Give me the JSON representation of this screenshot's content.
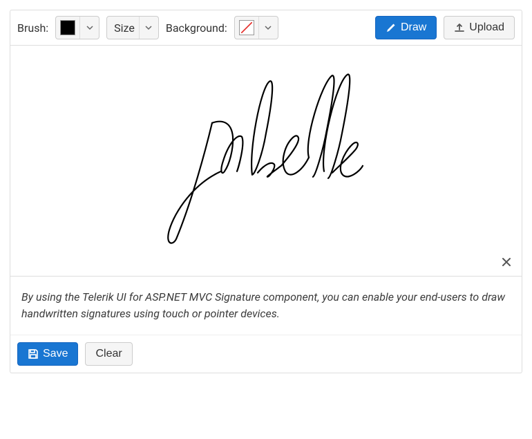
{
  "toolbar": {
    "brush_label": "Brush:",
    "size_label": "Size",
    "background_label": "Background:",
    "draw_label": "Draw",
    "upload_label": "Upload",
    "brush_color": "#000000",
    "background_value": "none"
  },
  "description": "By using the Telerik UI for ASP.NET MVC Signature component, you can enable your end-users to draw handwritten signatures using touch or pointer devices.",
  "footer": {
    "save_label": "Save",
    "clear_label": "Clear"
  }
}
